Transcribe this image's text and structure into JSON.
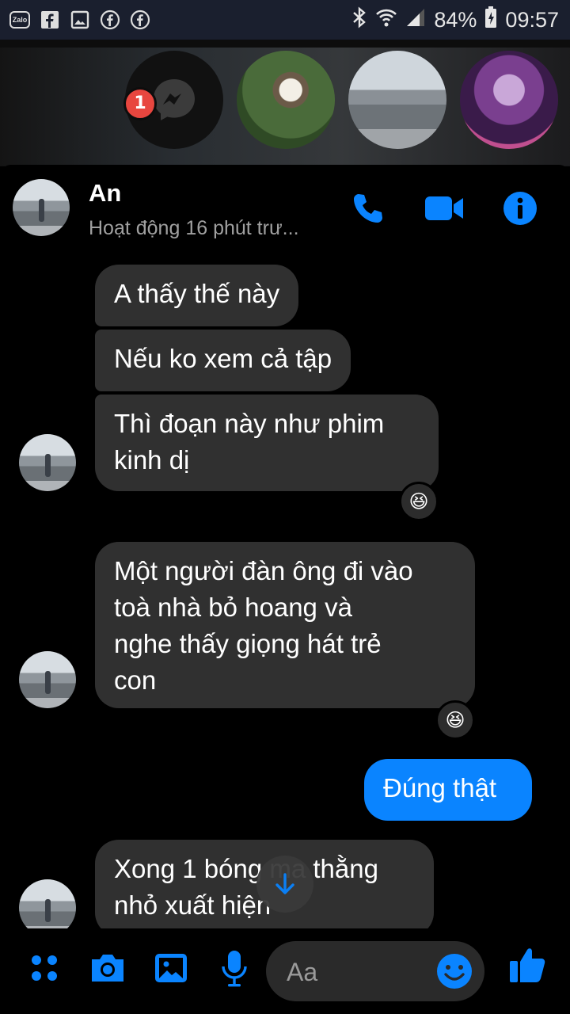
{
  "status_bar": {
    "left_icons": [
      "zalo-icon",
      "facebook-icon",
      "gallery-icon",
      "facebook-icon",
      "facebook-icon"
    ],
    "zalo_label": "Zalo",
    "battery": "84%",
    "time": "09:57"
  },
  "chat_heads": {
    "badge_count": "1"
  },
  "header": {
    "name": "An",
    "status": "Hoạt động 16 phút trư..."
  },
  "messages": [
    {
      "from": "contact",
      "text": "A thấy thế này"
    },
    {
      "from": "contact",
      "text": "Nếu ko xem cả tập"
    },
    {
      "from": "contact",
      "text": "Thì đoạn này như phim kinh dị",
      "line1": "Thì đoạn này như phim",
      "line2": "kinh dị",
      "reaction": "😆"
    },
    {
      "from": "contact",
      "line1": "Một người đàn ông đi vào",
      "line2": "toà nhà bỏ hoang và",
      "line3": "nghe thấy giọng hát trẻ",
      "line4": "con",
      "reaction": "😆"
    },
    {
      "from": "me",
      "text": "Đúng thật"
    },
    {
      "from": "contact",
      "line1": "Xong 1 bóng ma thằng",
      "line2": "nhỏ xuất hiện"
    }
  ],
  "composer": {
    "placeholder": "Aa"
  },
  "colors": {
    "accent": "#0a84ff",
    "incoming_bubble": "#303030",
    "badge": "#e8463f"
  }
}
